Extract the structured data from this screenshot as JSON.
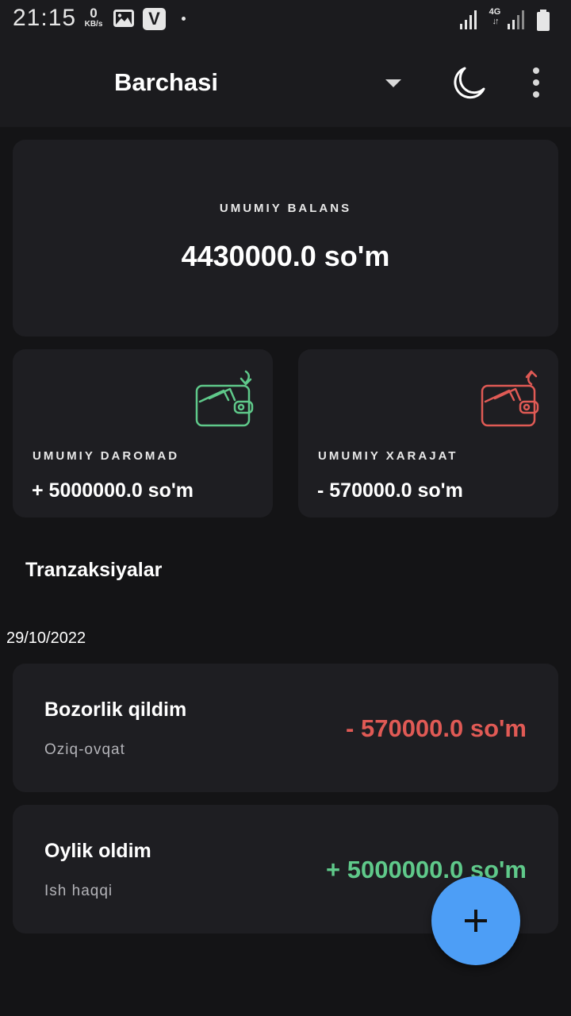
{
  "status_bar": {
    "time": "21:15",
    "net_speed_value": "0",
    "net_speed_unit": "KB/s",
    "network": "4G",
    "icons": [
      "gallery-icon",
      "v-app-icon",
      "signal-icon",
      "battery-icon"
    ]
  },
  "app_bar": {
    "title": "Barchasi",
    "icons": [
      "dropdown-arrow-icon",
      "moon-icon",
      "more-vert-icon"
    ]
  },
  "balance": {
    "label": "UMUMIY BALANS",
    "value": "4430000.0 so'm"
  },
  "income": {
    "label": "UMUMIY DAROMAD",
    "value": "+ 5000000.0 so'm",
    "icon": "wallet-income-icon",
    "color": "#5fc98a"
  },
  "expense": {
    "label": "UMUMIY XARAJAT",
    "value": "- 570000.0 so'm",
    "icon": "wallet-expense-icon",
    "color": "#e05a55"
  },
  "transactions": {
    "section_title": "Tranzaksiyalar",
    "groups": [
      {
        "date": "29/10/2022",
        "items": [
          {
            "title": "Bozorlik qildim",
            "category": "Oziq-ovqat",
            "amount": "- 570000.0 so'm",
            "type": "expense"
          },
          {
            "title": "Oylik oldim",
            "category": "Ish haqqi",
            "amount": "+ 5000000.0 so'm",
            "type": "income"
          }
        ]
      }
    ]
  },
  "fab": {
    "icon": "plus-icon",
    "color": "#4d9ef6"
  },
  "colors": {
    "background": "#141416",
    "card": "#1e1e22",
    "accent": "#4d9ef6",
    "income": "#5fc98a",
    "expense": "#e05a55"
  }
}
